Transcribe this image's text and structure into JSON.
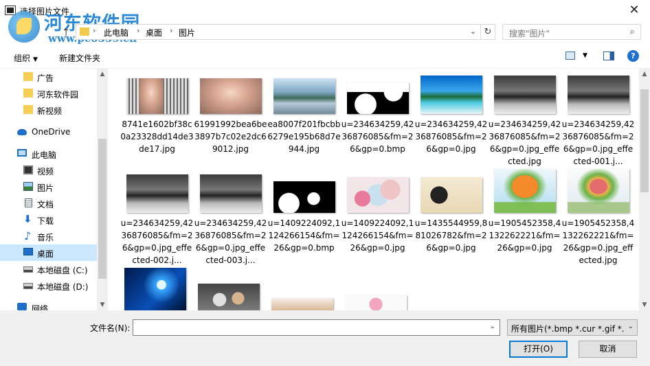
{
  "window": {
    "title": "选择图片文件"
  },
  "watermark": {
    "site": "河东软件园",
    "url": "www.pc0359.cn"
  },
  "address": {
    "crumbs": [
      "此电脑",
      "桌面",
      "图片"
    ]
  },
  "search": {
    "placeholder": "搜索\"图片\""
  },
  "toolbar": {
    "organize": "组织",
    "new_folder": "新建文件夹",
    "help": "?"
  },
  "nav": {
    "items": [
      {
        "label": "广告"
      },
      {
        "label": "河东软件园"
      },
      {
        "label": "新视频"
      },
      {
        "label": "OneDrive"
      },
      {
        "label": "此电脑"
      },
      {
        "label": "视频"
      },
      {
        "label": "图片"
      },
      {
        "label": "文档"
      },
      {
        "label": "下载"
      },
      {
        "label": "音乐"
      },
      {
        "label": "桌面"
      },
      {
        "label": "本地磁盘 (C:)"
      },
      {
        "label": "本地磁盘 (D:)"
      },
      {
        "label": "网络"
      }
    ]
  },
  "files": [
    {
      "name": "8741e1602bf38c0a23328dd14de3de17.jpg"
    },
    {
      "name": "61991992bea6be3897b7c02e2dc69012.jpg"
    },
    {
      "name": "ea8007f201fbcbb6279e195b68d7e944.jpg"
    },
    {
      "name": "u=234634259,4236876085&fm=26&gp=0.bmp"
    },
    {
      "name": "u=234634259,4236876085&fm=26&gp=0.jpg"
    },
    {
      "name": "u=234634259,4236876085&fm=26&gp=0.jpg_effected.jpg"
    },
    {
      "name": "u=234634259,4236876085&fm=26&gp=0.jpg_effected-001.j..."
    },
    {
      "name": "u=234634259,4236876085&fm=26&gp=0.jpg_effected-002.j..."
    },
    {
      "name": "u=234634259,4236876085&fm=26&gp=0.jpg_effected-003.j..."
    },
    {
      "name": "u=1409224092,1124266154&fm=26&gp=0.bmp"
    },
    {
      "name": "u=1409224092,1124266154&fm=26&gp=0.jpg"
    },
    {
      "name": "u=1435544959,881026782&fm=26&gp=0.jpg"
    },
    {
      "name": "u=1905452358,4132262221&fm=26&gp=0.jpg"
    },
    {
      "name": "u=1905452358,4132262221&fm=26&gp=0.jpg_effected.jpg"
    }
  ],
  "bottom": {
    "filename_label": "文件名(N):",
    "filename_value": "",
    "filter": "所有图片(*.bmp *.cur *.gif *.ic",
    "open": "打开(O)",
    "cancel": "取消"
  }
}
